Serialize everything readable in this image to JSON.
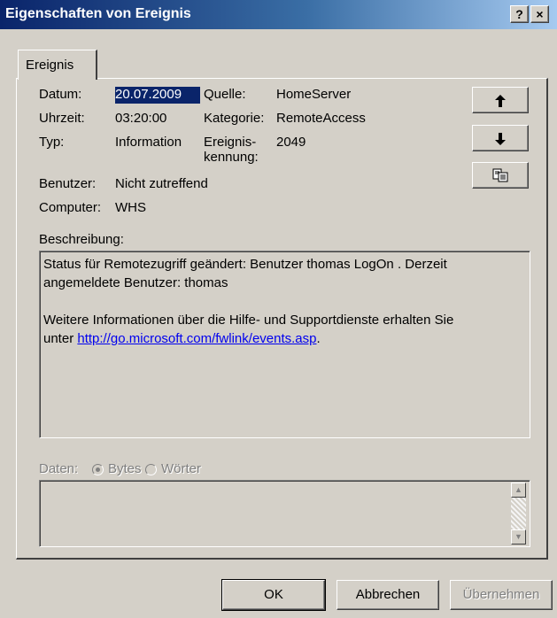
{
  "window": {
    "title": "Eigenschaften von Ereignis",
    "help_button": "?",
    "close_button": "×"
  },
  "tab": {
    "label": "Ereignis"
  },
  "fields": {
    "datum": {
      "label": "Datum:",
      "value": "20.07.2009"
    },
    "uhrzeit": {
      "label": "Uhrzeit:",
      "value": "03:20:00"
    },
    "typ": {
      "label": "Typ:",
      "value": "Information"
    },
    "benutzer": {
      "label": "Benutzer:",
      "value": "Nicht zutreffend"
    },
    "computer": {
      "label": "Computer:",
      "value": "WHS"
    },
    "quelle": {
      "label": "Quelle:",
      "value": "HomeServer"
    },
    "kategorie": {
      "label": "Kategorie:",
      "value": "RemoteAccess"
    },
    "ereigniskennung": {
      "label_line1": "Ereignis-",
      "label_line2": "kennung:",
      "value": "2049"
    }
  },
  "nav_buttons": {
    "up_icon": "arrow-up-icon",
    "down_icon": "arrow-down-icon",
    "copy_icon": "copy-icon"
  },
  "description": {
    "label": "Beschreibung:",
    "line1": "Status für Remotezugriff geändert: Benutzer thomas LogOn . Derzeit",
    "line2": "angemeldete Benutzer: thomas",
    "line3": "Weitere Informationen über die Hilfe- und Supportdienste erhalten Sie",
    "line4_prefix": "unter",
    "link": "http://go.microsoft.com/fwlink/events.asp",
    "line4_suffix": "."
  },
  "data_section": {
    "label": "Daten:",
    "option_bytes": "Bytes",
    "option_words": "Wörter",
    "selected": "Bytes"
  },
  "footer": {
    "ok": "OK",
    "cancel": "Abbrechen",
    "apply": "Übernehmen"
  },
  "colors": {
    "title_gradient_start": "#0a246a",
    "title_gradient_end": "#a6caf0",
    "dialog_bg": "#d4d0c8",
    "selection": "#0a246a",
    "link": "#0000ee"
  }
}
